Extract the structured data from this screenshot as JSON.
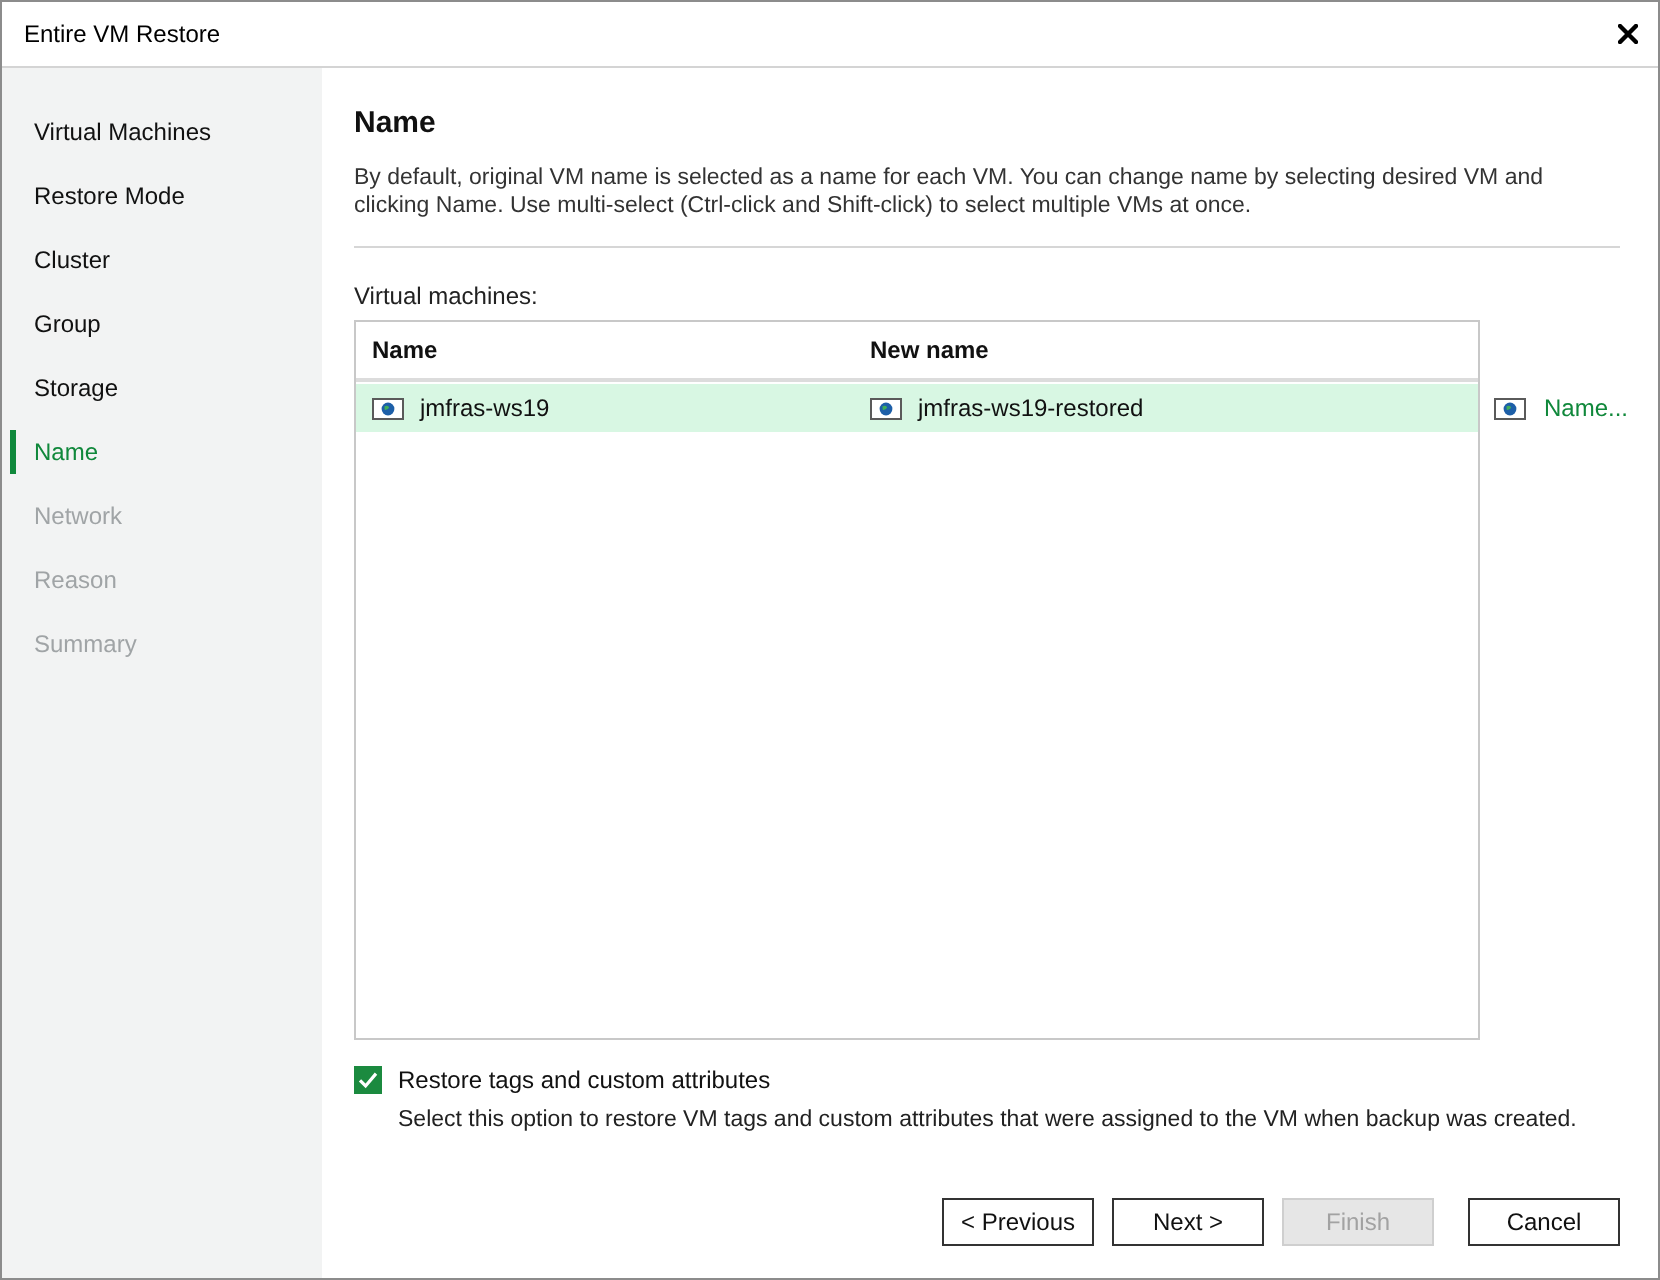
{
  "window": {
    "title": "Entire VM Restore"
  },
  "sidebar": {
    "items": [
      {
        "label": "Virtual Machines",
        "selected": false,
        "disabled": false
      },
      {
        "label": "Restore Mode",
        "selected": false,
        "disabled": false
      },
      {
        "label": "Cluster",
        "selected": false,
        "disabled": false
      },
      {
        "label": "Group",
        "selected": false,
        "disabled": false
      },
      {
        "label": "Storage",
        "selected": false,
        "disabled": false
      },
      {
        "label": "Name",
        "selected": true,
        "disabled": false
      },
      {
        "label": "Network",
        "selected": false,
        "disabled": true
      },
      {
        "label": "Reason",
        "selected": false,
        "disabled": true
      },
      {
        "label": "Summary",
        "selected": false,
        "disabled": true
      }
    ]
  },
  "page": {
    "heading": "Name",
    "description": "By default, original VM name is selected as a name for each VM. You can change name by selecting desired VM and clicking Name. Use multi-select (Ctrl-click and Shift-click) to select multiple VMs at once.",
    "list_label": "Virtual machines:"
  },
  "table": {
    "columns": [
      "Name",
      "New name"
    ],
    "rows": [
      {
        "name": "jmfras-ws19",
        "new_name": "jmfras-ws19-restored",
        "selected": true
      }
    ]
  },
  "name_button": {
    "label": "Name..."
  },
  "option": {
    "label": "Restore tags and custom attributes",
    "checked": true,
    "hint": "Select this option to restore VM tags and custom attributes that were assigned to the VM when backup was created."
  },
  "buttons": [
    {
      "label": "< Previous",
      "disabled": false
    },
    {
      "label": "Next >",
      "disabled": false
    },
    {
      "label": "Finish",
      "disabled": true
    },
    {
      "label": "Cancel",
      "disabled": false
    }
  ]
}
